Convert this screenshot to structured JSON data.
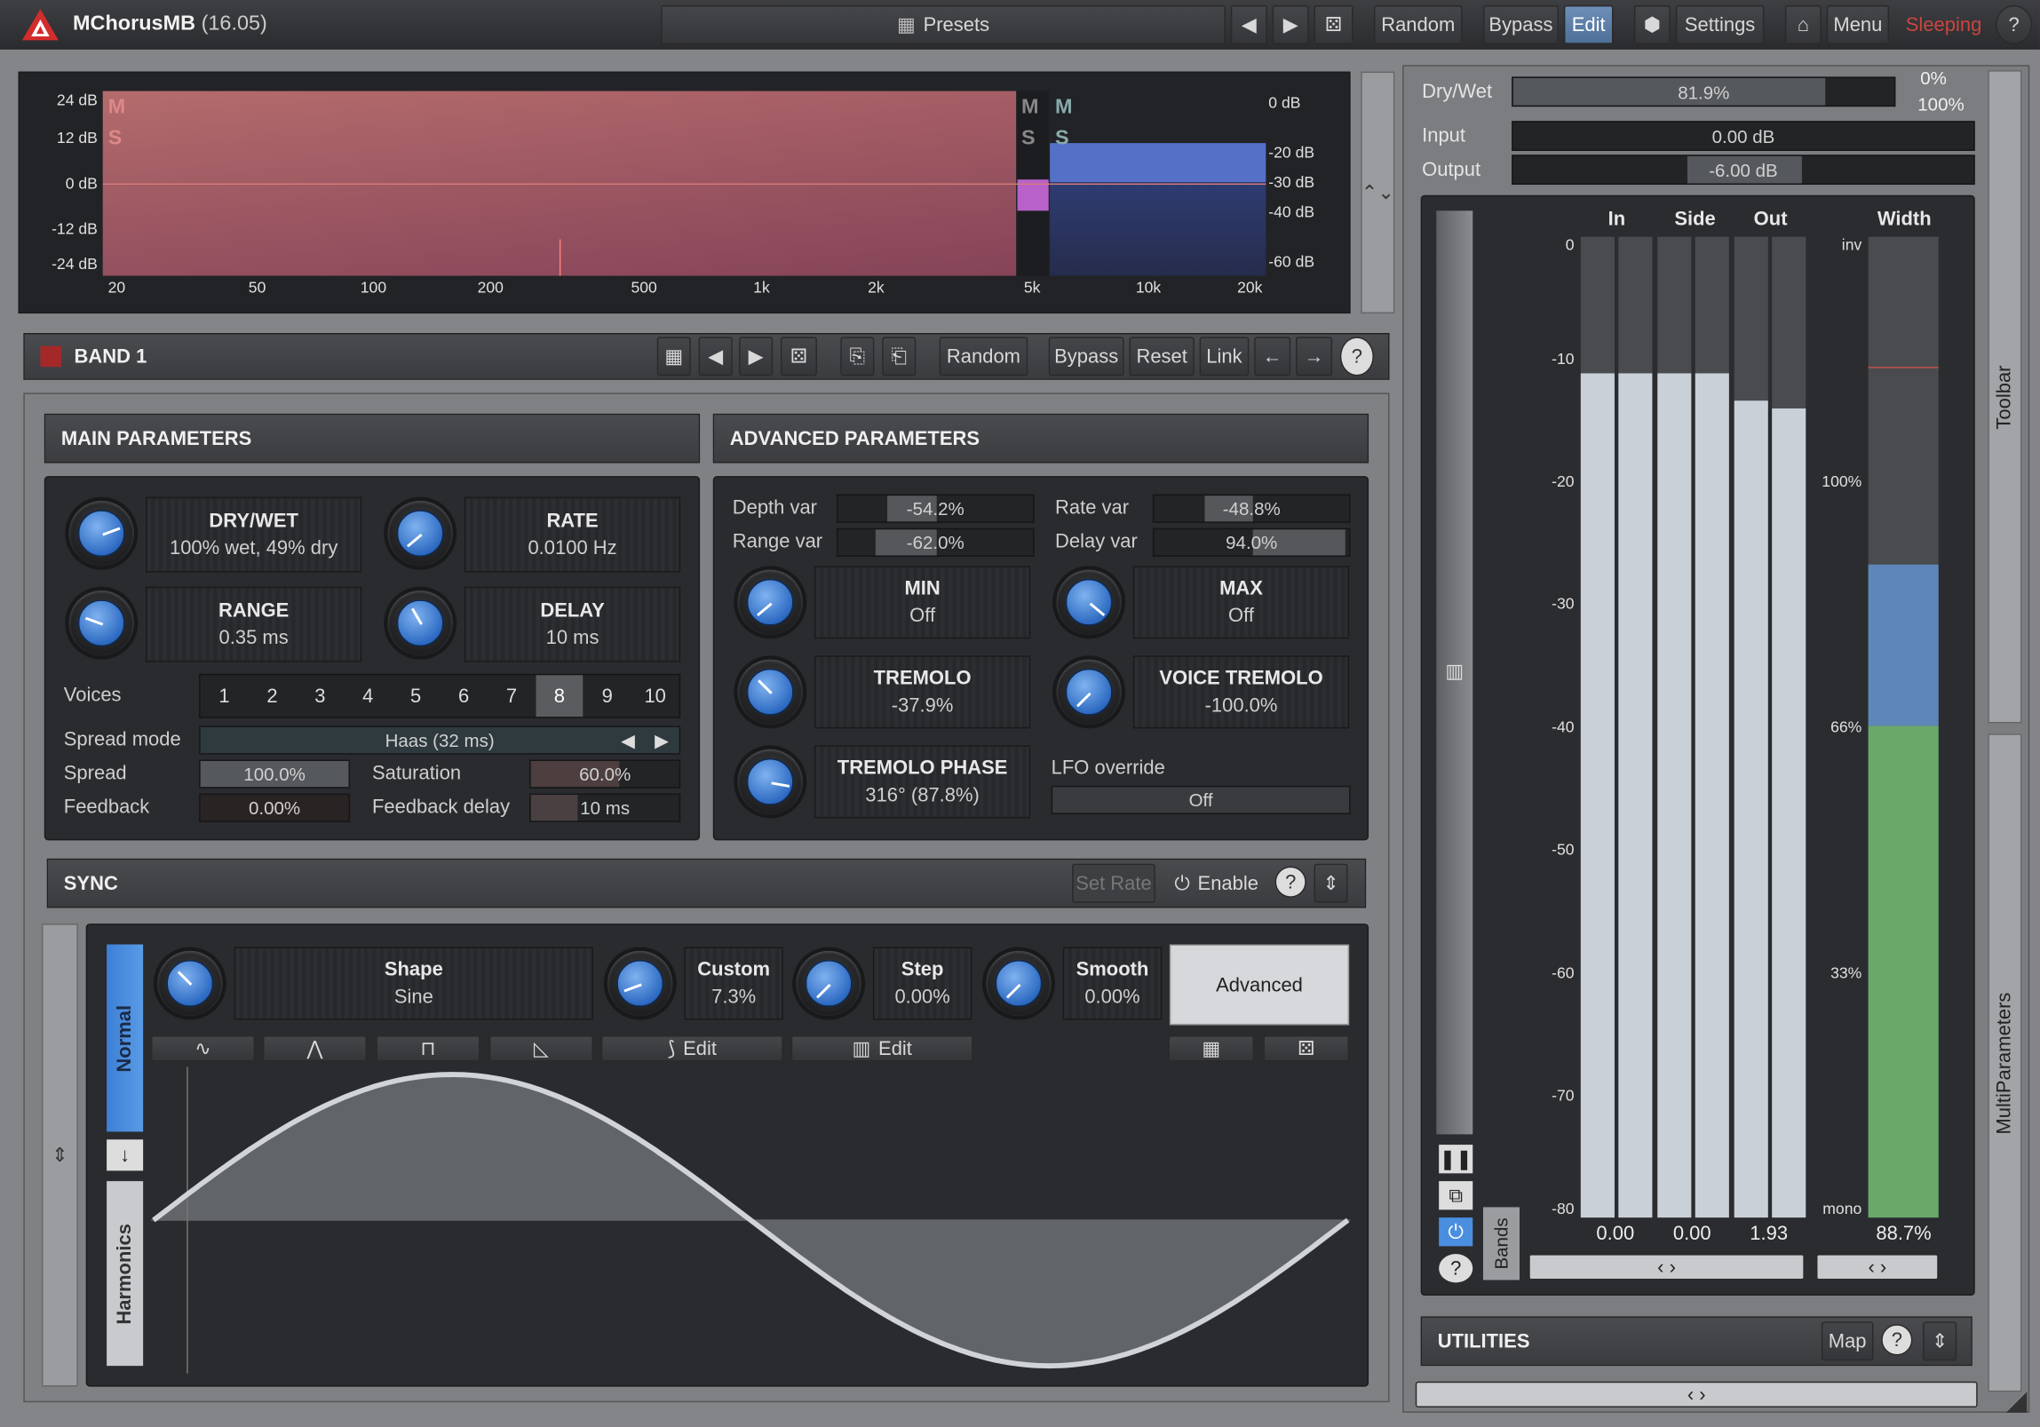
{
  "app": {
    "title": "MChorusMB",
    "version": "(16.05)"
  },
  "topbar": {
    "presets": "Presets",
    "random": "Random",
    "bypass": "Bypass",
    "edit": "Edit",
    "settings": "Settings",
    "menu": "Menu",
    "sleeping": "Sleeping"
  },
  "spectrum": {
    "left_ticks": [
      "24 dB",
      "12 dB",
      "0 dB",
      "-12 dB",
      "-24 dB"
    ],
    "right_ticks": [
      "0 dB",
      "-20 dB",
      "-30 dB",
      "-40 dB",
      "-60 dB"
    ],
    "freq_ticks": [
      "20",
      "50",
      "100",
      "200",
      "500",
      "1k",
      "2k",
      "5k",
      "10k",
      "20k"
    ],
    "band_letters": [
      "M",
      "S",
      "M",
      "S"
    ]
  },
  "global": {
    "drywet_label": "Dry/Wet",
    "drywet_value": "81.9%",
    "drywet_fraction": 0.819,
    "drywet_top": "0%",
    "drywet_bottom": "100%",
    "input_label": "Input",
    "input_value": "0.00 dB",
    "output_label": "Output",
    "output_value": "-6.00 dB"
  },
  "band": {
    "name": "BAND 1",
    "random": "Random",
    "bypass": "Bypass",
    "reset": "Reset",
    "link": "Link"
  },
  "main": {
    "title": "MAIN PARAMETERS",
    "drywet_t": "DRY/WET",
    "drywet_v": "100% wet, 49% dry",
    "rate_t": "RATE",
    "rate_v": "0.0100 Hz",
    "range_t": "RANGE",
    "range_v": "0.35 ms",
    "delay_t": "DELAY",
    "delay_v": "10 ms",
    "voices_label": "Voices",
    "voices": [
      "1",
      "2",
      "3",
      "4",
      "5",
      "6",
      "7",
      "8",
      "9",
      "10"
    ],
    "voices_selected": 8,
    "spreadmode_label": "Spread mode",
    "spreadmode_value": "Haas (32 ms)",
    "spread_label": "Spread",
    "spread_value": "100.0%",
    "saturation_label": "Saturation",
    "saturation_value": "60.0%",
    "feedback_label": "Feedback",
    "feedback_value": "0.00%",
    "fbdelay_label": "Feedback delay",
    "fbdelay_value": "10 ms"
  },
  "adv": {
    "title": "ADVANCED PARAMETERS",
    "depthvar_label": "Depth var",
    "depthvar_value": "-54.2%",
    "ratevar_label": "Rate var",
    "ratevar_value": "-48.8%",
    "rangevar_label": "Range var",
    "rangevar_value": "-62.0%",
    "delayvar_label": "Delay var",
    "delayvar_value": "94.0%",
    "min_t": "MIN",
    "min_v": "Off",
    "max_t": "MAX",
    "max_v": "Off",
    "tremolo_t": "TREMOLO",
    "tremolo_v": "-37.9%",
    "vtremolo_t": "VOICE TREMOLO",
    "vtremolo_v": "-100.0%",
    "tphase_t": "TREMOLO PHASE",
    "tphase_v": "316° (87.8%)",
    "lfo_label": "LFO override",
    "lfo_value": "Off"
  },
  "sync": {
    "title": "SYNC",
    "setrate": "Set Rate",
    "enable": "Enable"
  },
  "lfo": {
    "normal": "Normal",
    "harmonics": "Harmonics",
    "shape_t": "Shape",
    "shape_v": "Sine",
    "custom_t": "Custom",
    "custom_v": "7.3%",
    "step_t": "Step",
    "step_v": "0.00%",
    "smooth_t": "Smooth",
    "smooth_v": "0.00%",
    "advanced": "Advanced",
    "edit1": "Edit",
    "edit2": "Edit"
  },
  "meters": {
    "col_in": "In",
    "col_side": "Side",
    "col_out": "Out",
    "col_width": "Width",
    "scale": [
      "0",
      "-10",
      "-20",
      "-30",
      "-40",
      "-50",
      "-60",
      "-70",
      "-80"
    ],
    "width_scale": [
      "inv",
      "100%",
      "66%",
      "33%",
      "mono"
    ],
    "in_value": "0.00",
    "side_value": "0.00",
    "out_value": "1.93",
    "width_value": "88.7%",
    "bands": "Bands",
    "toolbar": "Toolbar",
    "multiparams": "MultiParameters"
  },
  "utilities": {
    "title": "UTILITIES",
    "map": "Map"
  },
  "colors": {
    "accent": "#4a8ee0",
    "band_red": "#b33a3a",
    "width_green": "#6aa86a",
    "width_blue": "#5f86b8"
  }
}
